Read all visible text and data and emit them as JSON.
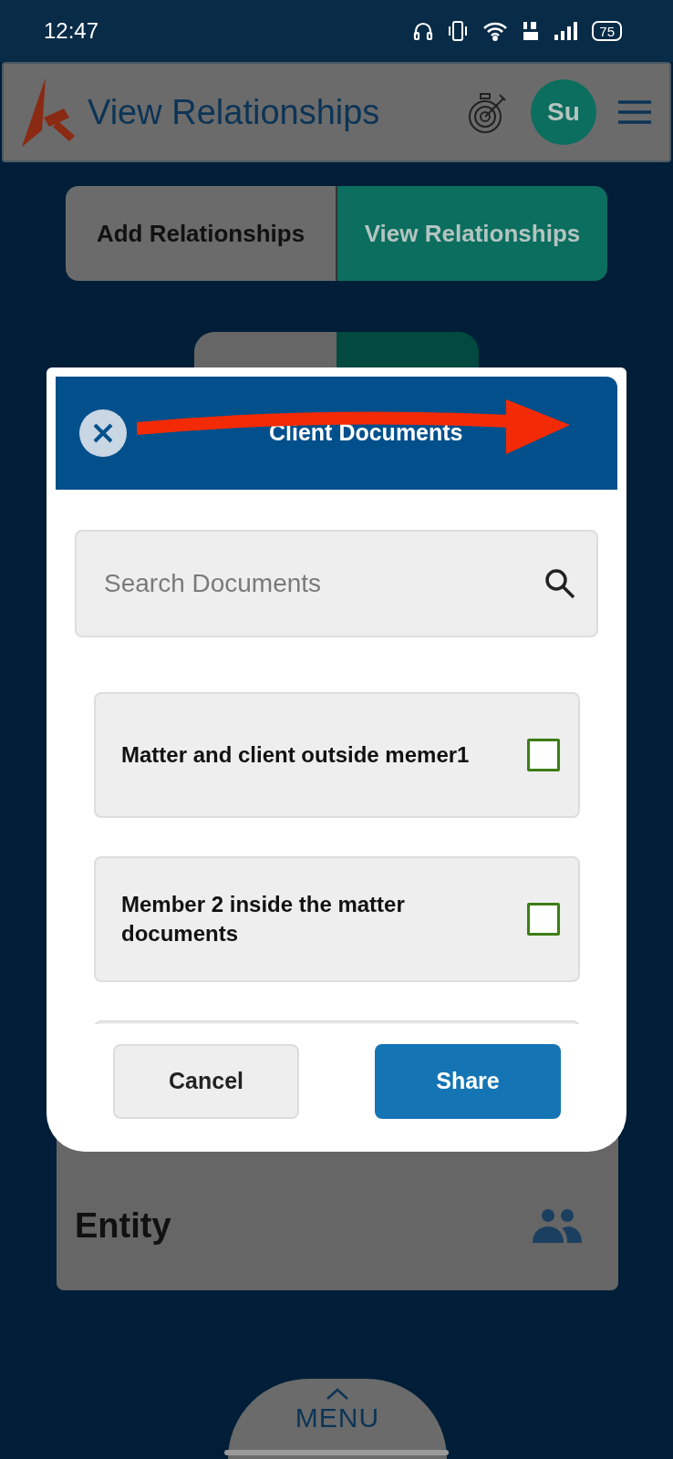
{
  "status_bar": {
    "time": "12:47",
    "battery": "75"
  },
  "app_bar": {
    "title": "View Relationships",
    "avatar": "Su"
  },
  "tabs": [
    {
      "label": "Add Relationships",
      "selected": false
    },
    {
      "label": "View Relationships",
      "selected": true
    }
  ],
  "toggle": [
    {
      "selected": false
    },
    {
      "selected": true
    }
  ],
  "background_card": {
    "title": "Entity"
  },
  "menu": {
    "label": "MENU"
  },
  "dialog": {
    "title": "Client Documents",
    "search": {
      "placeholder": "Search Documents"
    },
    "documents": [
      {
        "name": "Matter and client outside memer1",
        "checked": false
      },
      {
        "name": "Member 2 inside the matter documents",
        "checked": false
      }
    ],
    "buttons": [
      {
        "label": "Cancel",
        "kind": "secondary"
      },
      {
        "label": "Share",
        "kind": "primary"
      }
    ]
  }
}
